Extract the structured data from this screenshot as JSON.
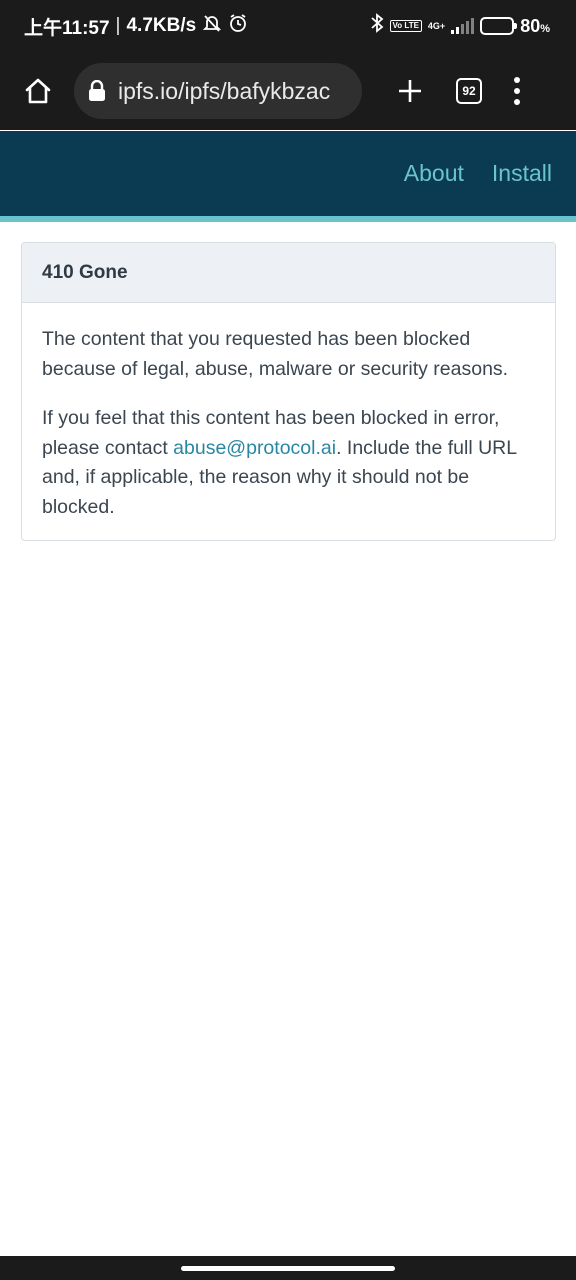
{
  "status_bar": {
    "time": "上午11:57",
    "separator": "|",
    "net_speed": "4.7KB/s",
    "volte_badge": "Vo LTE",
    "network_type": "4G+",
    "battery_percent": "80",
    "battery_unit": "%",
    "battery_level": 0.8,
    "icons": [
      "mute-bell-icon",
      "alarm-icon",
      "bluetooth-icon",
      "signal-icon",
      "battery-icon"
    ]
  },
  "browser": {
    "url": "ipfs.io/ipfs/bafykbzac",
    "tab_count": "92",
    "icons": [
      "home-icon",
      "lock-icon",
      "plus-icon",
      "tabs-icon",
      "overflow-menu-icon"
    ]
  },
  "site_header": {
    "nav": [
      {
        "label": "About"
      },
      {
        "label": "Install"
      }
    ],
    "accent_color": "#6bc2cc",
    "background_color": "#0b3a53"
  },
  "error_card": {
    "title": "410 Gone",
    "paragraph1": "The content that you requested has been blocked because of legal, abuse, malware or security reasons.",
    "paragraph2_before": "If you feel that this content has been blocked in error, please contact ",
    "contact_email": "abuse@protocol.ai",
    "paragraph2_after": ". Include the full URL and, if applicable, the reason why it should not be blocked."
  }
}
